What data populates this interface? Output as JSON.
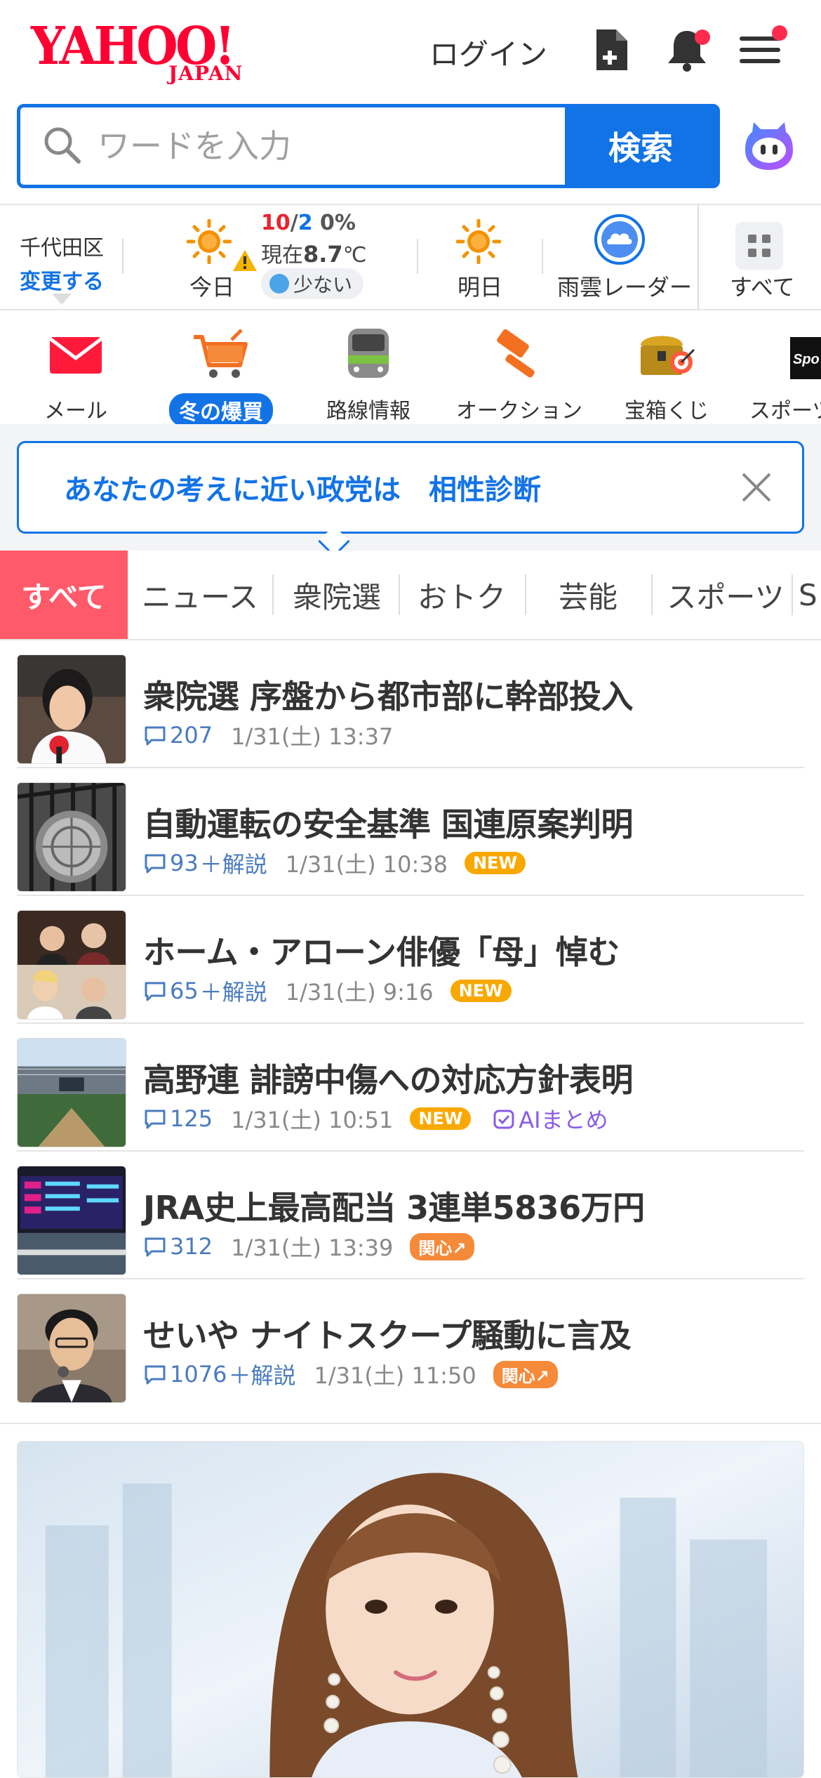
{
  "header": {
    "logo_text": "YAHOO!",
    "logo_sub": "JAPAN",
    "login_label": "ログイン"
  },
  "search": {
    "placeholder": "ワードを入力",
    "button_label": "検索"
  },
  "weather": {
    "location": "千代田区",
    "change_label": "変更する",
    "today_label": "今日",
    "high": "10",
    "slash": "/",
    "low": "2",
    "precip": "0%",
    "now_prefix": "現在",
    "now_temp": "8.7",
    "now_unit": "℃",
    "pollen": "少ない",
    "tomorrow_label": "明日",
    "radar_label": "雨雲レーダー",
    "all_label": "すべて"
  },
  "services": [
    {
      "label": "メール"
    },
    {
      "label": "冬の爆買"
    },
    {
      "label": "路線情報"
    },
    {
      "label": "オークション"
    },
    {
      "label": "宝箱くじ"
    },
    {
      "label": "スポーツ"
    }
  ],
  "banner": {
    "text": "あなたの考えに近い政党は　相性診断"
  },
  "tabs": [
    {
      "label": "すべて"
    },
    {
      "label": "ニュース"
    },
    {
      "label": "衆院選"
    },
    {
      "label": "おトク"
    },
    {
      "label": "芸能"
    },
    {
      "label": "スポーツ"
    },
    {
      "label": "S"
    }
  ],
  "news": [
    {
      "title": "衆院選 序盤から都市部に幹部投入",
      "comments": "207",
      "kaisetsu": "",
      "time": "1/31(土) 13:37",
      "badge": "",
      "ai": ""
    },
    {
      "title": "自動運転の安全基準 国連原案判明",
      "comments": "93",
      "kaisetsu": "＋解説",
      "time": "1/31(土) 10:38",
      "badge": "NEW",
      "ai": ""
    },
    {
      "title": "ホーム・アローン俳優「母」悼む",
      "comments": "65",
      "kaisetsu": "＋解説",
      "time": "1/31(土) 9:16",
      "badge": "NEW",
      "ai": ""
    },
    {
      "title": "高野連 誹謗中傷への対応方針表明",
      "comments": "125",
      "kaisetsu": "",
      "time": "1/31(土) 10:51",
      "badge": "NEW",
      "ai": "AIまとめ"
    },
    {
      "title": "JRA史上最高配当 3連単5836万円",
      "comments": "312",
      "kaisetsu": "",
      "time": "1/31(土) 13:39",
      "badge": "関心↗",
      "ai": ""
    },
    {
      "title": "せいや ナイトスクープ騒動に言及",
      "comments": "1076",
      "kaisetsu": "＋解説",
      "time": "1/31(土) 11:50",
      "badge": "関心↗",
      "ai": ""
    }
  ],
  "colors": {
    "brand_red": "#ff0033",
    "accent_blue": "#1273e6",
    "tab_active": "#ff5a6a",
    "badge_new": "#f8a800",
    "badge_interest": "#f58a3a"
  },
  "icons": {
    "header": [
      "new-document-icon",
      "bell-icon",
      "hamburger-menu-icon"
    ],
    "search": "search-icon",
    "assistant": "ai-assistant-icon"
  }
}
